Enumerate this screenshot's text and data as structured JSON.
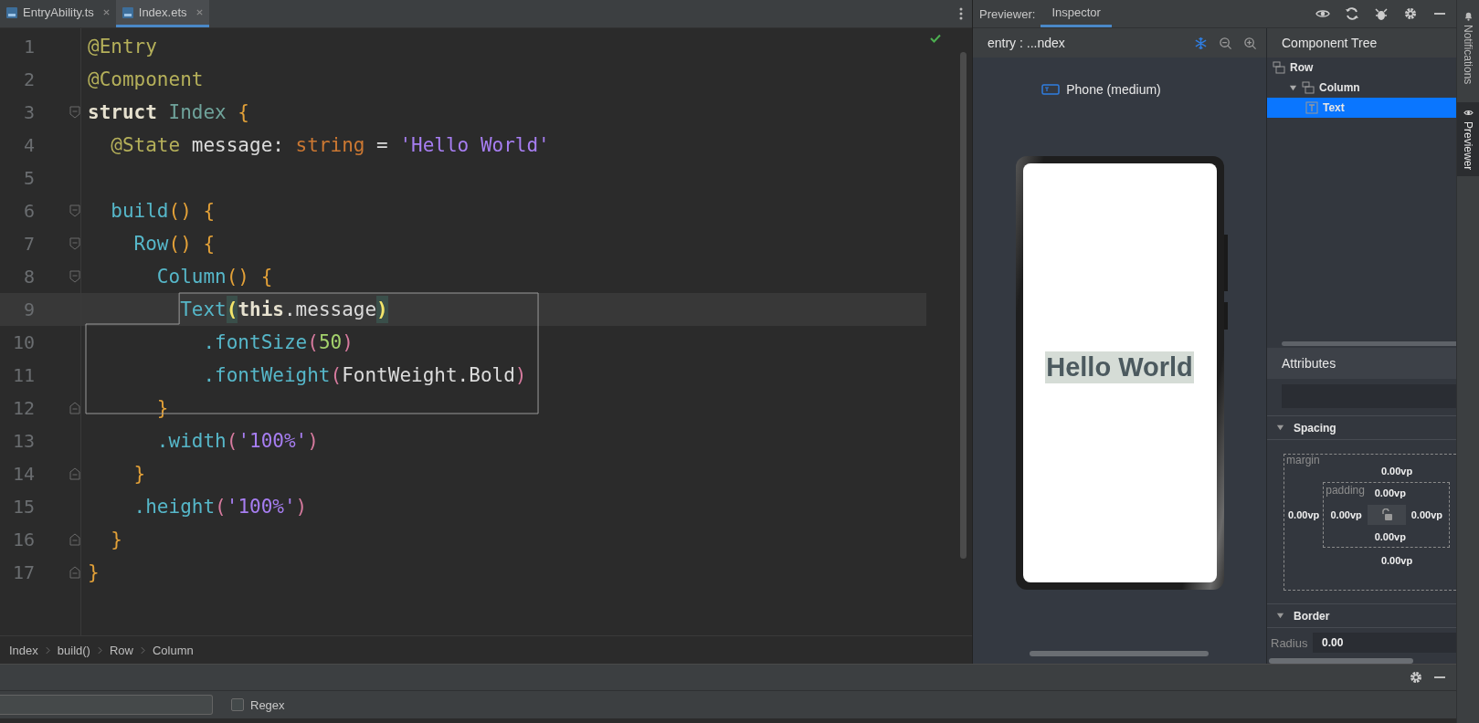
{
  "editor": {
    "tabs": [
      {
        "label": "EntryAbility.ts",
        "selected": false
      },
      {
        "label": "Index.ets",
        "selected": true
      }
    ],
    "lines": [
      {
        "number": "1",
        "kind": "code",
        "current": false,
        "tokens": [
          {
            "text": "@Entry",
            "kind": "annotation"
          }
        ]
      },
      {
        "number": "2",
        "kind": "code",
        "current": false,
        "tokens": [
          {
            "text": "@Component",
            "kind": "annotation"
          }
        ]
      },
      {
        "number": "3",
        "kind": "fold-start",
        "current": false,
        "tokens": [
          {
            "text": "struct",
            "kind": "keyword"
          },
          {
            "text": " Index",
            "kind": "class"
          },
          {
            "text": " {",
            "kind": "brace"
          }
        ]
      },
      {
        "number": "4",
        "kind": "code",
        "current": false,
        "tokens": [
          {
            "text": "  @State",
            "kind": "annotation"
          },
          {
            "text": " message: ",
            "kind": "plain"
          },
          {
            "text": "string",
            "kind": "type"
          },
          {
            "text": " = ",
            "kind": "plain"
          },
          {
            "text": "'Hello World'",
            "kind": "string"
          }
        ]
      },
      {
        "number": "5",
        "kind": "code"
      },
      {
        "number": "6",
        "kind": "fold-start",
        "current": false,
        "tokens": [
          {
            "text": "  build",
            "kind": "function"
          },
          {
            "text": "()",
            "kind": "brace"
          },
          {
            "text": " {",
            "kind": "brace"
          }
        ]
      },
      {
        "number": "7",
        "kind": "fold-start",
        "current": false,
        "tokens": [
          {
            "text": "    Row",
            "kind": "function"
          },
          {
            "text": "()",
            "kind": "brace"
          },
          {
            "text": " {",
            "kind": "brace"
          }
        ]
      },
      {
        "number": "8",
        "kind": "fold-start",
        "current": false,
        "tokens": [
          {
            "text": "      Column",
            "kind": "function"
          },
          {
            "text": "()",
            "kind": "brace"
          },
          {
            "text": " {",
            "kind": "brace"
          }
        ]
      },
      {
        "number": "9",
        "kind": "code",
        "current": true,
        "tokens": [
          {
            "text": "        Text",
            "kind": "function"
          },
          {
            "text": "(",
            "kind": "paren-match"
          },
          {
            "text": "this",
            "kind": "this"
          },
          {
            "text": ".message",
            "kind": "plain"
          },
          {
            "text": ")",
            "kind": "paren-match"
          }
        ]
      },
      {
        "number": "10",
        "kind": "code",
        "current": false,
        "tokens": [
          {
            "text": "          .fontSize",
            "kind": "function"
          },
          {
            "text": "(",
            "kind": "paren"
          },
          {
            "text": "50",
            "kind": "number"
          },
          {
            "text": ")",
            "kind": "paren"
          }
        ]
      },
      {
        "number": "11",
        "kind": "code",
        "current": false,
        "tokens": [
          {
            "text": "          .fontWeight",
            "kind": "function"
          },
          {
            "text": "(",
            "kind": "paren"
          },
          {
            "text": "FontWeight.Bold",
            "kind": "plain"
          },
          {
            "text": ")",
            "kind": "paren"
          }
        ]
      },
      {
        "number": "12",
        "kind": "fold-end",
        "current": false,
        "tokens": [
          {
            "text": "      }",
            "kind": "brace"
          }
        ]
      },
      {
        "number": "13",
        "kind": "code",
        "current": false,
        "tokens": [
          {
            "text": "      .width",
            "kind": "function"
          },
          {
            "text": "(",
            "kind": "paren"
          },
          {
            "text": "'100%'",
            "kind": "string"
          },
          {
            "text": ")",
            "kind": "paren"
          }
        ]
      },
      {
        "number": "14",
        "kind": "fold-end",
        "current": false,
        "tokens": [
          {
            "text": "    }",
            "kind": "brace"
          }
        ]
      },
      {
        "number": "15",
        "kind": "code",
        "current": false,
        "tokens": [
          {
            "text": "    .height",
            "kind": "function"
          },
          {
            "text": "(",
            "kind": "paren"
          },
          {
            "text": "'100%'",
            "kind": "string"
          },
          {
            "text": ")",
            "kind": "paren"
          }
        ]
      },
      {
        "number": "16",
        "kind": "fold-end",
        "current": false,
        "tokens": [
          {
            "text": "  }",
            "kind": "brace"
          }
        ]
      },
      {
        "number": "17",
        "kind": "fold-end",
        "current": false,
        "tokens": [
          {
            "text": "}",
            "kind": "brace"
          }
        ]
      }
    ],
    "breadcrumb": [
      "Index",
      "build()",
      "Row",
      "Column"
    ]
  },
  "previewer": {
    "label": "Previewer:",
    "tabs": [
      {
        "label": "Inspector",
        "selected": true
      }
    ],
    "location": "entry : ...ndex",
    "device": "Phone (medium)",
    "preview_text": "Hello World"
  },
  "inspector": {
    "title": "Component Tree",
    "tree": [
      {
        "label": "Row",
        "kind": "container",
        "selected": false,
        "children": [
          {
            "label": "Column",
            "kind": "container",
            "selected": false,
            "expanded": true,
            "children": [
              {
                "label": "Text",
                "kind": "text",
                "selected": true
              }
            ]
          }
        ]
      }
    ],
    "attributes_title": "Attributes",
    "sections": [
      {
        "title": "Spacing",
        "kind": "spacing",
        "expanded": true,
        "margin_label": "margin",
        "margin": {
          "top": "0.00vp",
          "left": "0.00vp",
          "bottom": "0.00vp"
        },
        "padding_label": "padding",
        "padding": {
          "top": "0.00vp",
          "left": "0.00vp",
          "right": "0.00vp",
          "bottom": "0.00vp"
        }
      },
      {
        "title": "Border",
        "kind": "border",
        "expanded": true,
        "radius_label": "Radius",
        "radius": "0.00"
      }
    ]
  },
  "side_strip": [
    {
      "label": "Notifications",
      "kind": "bell",
      "selected": false
    },
    {
      "label": "Previewer",
      "kind": "eye",
      "selected": true
    }
  ],
  "find_bar": {
    "regex": {
      "label": "Regex",
      "checked": false
    }
  }
}
